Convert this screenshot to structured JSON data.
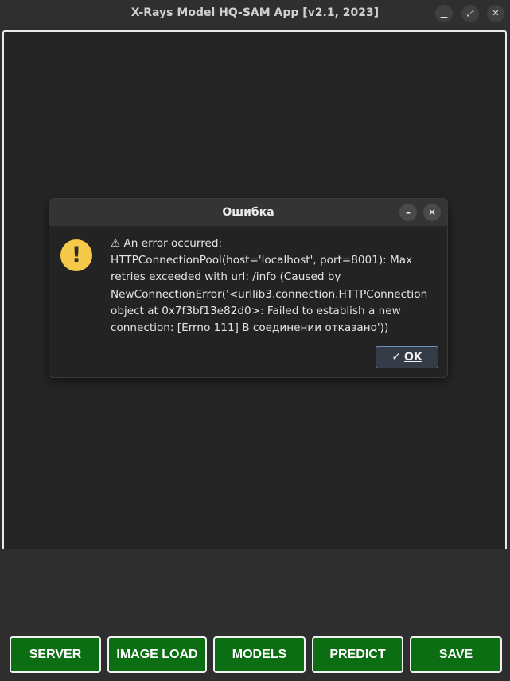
{
  "window": {
    "title": "X-Rays Model HQ-SAM App [v2.1, 2023]",
    "controls": {
      "minimize_icon": "minimize-icon",
      "maximize_icon": "maximize-icon",
      "close_icon": "close-icon"
    }
  },
  "dialog": {
    "title": "Ошибка",
    "icon": "warning-icon",
    "message": "⚠ An error occurred:\nHTTPConnectionPool(host='localhost', port=8001): Max\nretries exceeded with url: /info (Caused by\nNewConnectionError('<urllib3.connection.HTTPConnection\nobject at 0x7f3bf13e82d0>: Failed to establish a new\nconnection: [Errno 111] В соединении отказано'))",
    "ok_label": "OK"
  },
  "toolbar": {
    "buttons": [
      "SERVER",
      "IMAGE LOAD",
      "MODELS",
      "PREDICT",
      "SAVE"
    ]
  },
  "colors": {
    "button_green": "#0b6e13",
    "warning_yellow": "#f7c948",
    "ok_border": "#6d8fb8"
  }
}
